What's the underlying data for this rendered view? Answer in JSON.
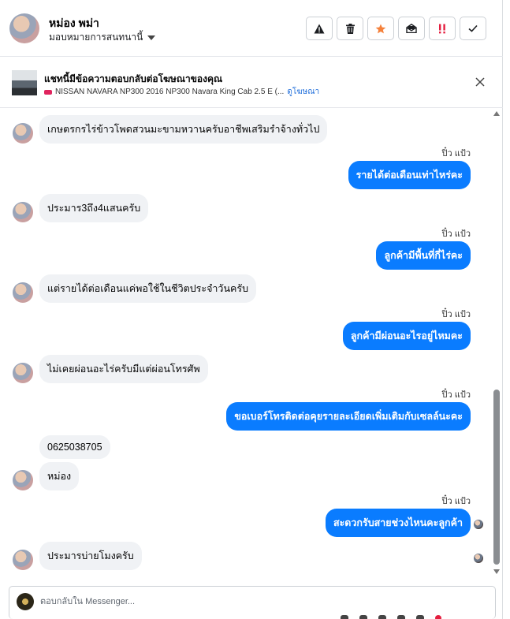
{
  "header": {
    "name": "หม่อง พม่า",
    "assign_label": "มอบหมายการสนทนานี้",
    "actions": [
      {
        "icon": "warning-icon"
      },
      {
        "icon": "trash-icon"
      },
      {
        "icon": "star-icon"
      },
      {
        "icon": "mark-unread-icon"
      },
      {
        "icon": "priority-icon"
      },
      {
        "icon": "checkmark-icon"
      }
    ]
  },
  "ad": {
    "title": "แชทนี้มีข้อความตอบกลับต่อโฆษณาของคุณ",
    "subtitle": "NISSAN NAVARA NP300 2016 NP300 Navara King Cab 2.5 E (...",
    "link": "ดูโฆษณา"
  },
  "chat": {
    "sender_name": "ปิ๋ว แป้ว",
    "messages": [
      {
        "dir": "in",
        "text": "เกษตรกรไร่ข้าวโพดสวนมะขามหวานครับอาชีพเสริมรำจ้างทั่วไป"
      },
      {
        "dir": "out",
        "text": "รายได้ต่อเดือนเท่าไหร่คะ"
      },
      {
        "dir": "in",
        "text": "ประมาร3ถึง4แสนครับ"
      },
      {
        "dir": "out",
        "text": "ลูกค้ามีพื้นที่กี่ไร่คะ"
      },
      {
        "dir": "in",
        "text": "แต่รายได้ต่อเดือนแค่พอใช้ในชีวิตประจำวันครับ"
      },
      {
        "dir": "out",
        "text": "ลูกค้ามีผ่อนอะไรอยู่ไหมคะ"
      },
      {
        "dir": "in",
        "text": "ไม่เคยผ่อนอะไร่ครับมีแต่ผ่อนโทรศัพ"
      },
      {
        "dir": "out",
        "text": "ขอเบอร์โทรติดต่อคุยรายละเอียดเพิ่มเติมกับเซลล์นะคะ"
      },
      {
        "dir": "in",
        "text": "0625038705"
      },
      {
        "dir": "in",
        "text": "หม่อง"
      },
      {
        "dir": "out",
        "text": "สะดวกรับสายช่วงไหนคะลูกค้า"
      },
      {
        "dir": "in",
        "text": "ประมารบ่ายโมงครับ"
      }
    ]
  },
  "composer": {
    "placeholder": "ตอบกลับใน Messenger..."
  },
  "colors": {
    "outgoing_bubble": "#0a7cff",
    "incoming_bubble": "#f0f2f5",
    "star": "#f5813b",
    "priority": "#e41e3f"
  }
}
